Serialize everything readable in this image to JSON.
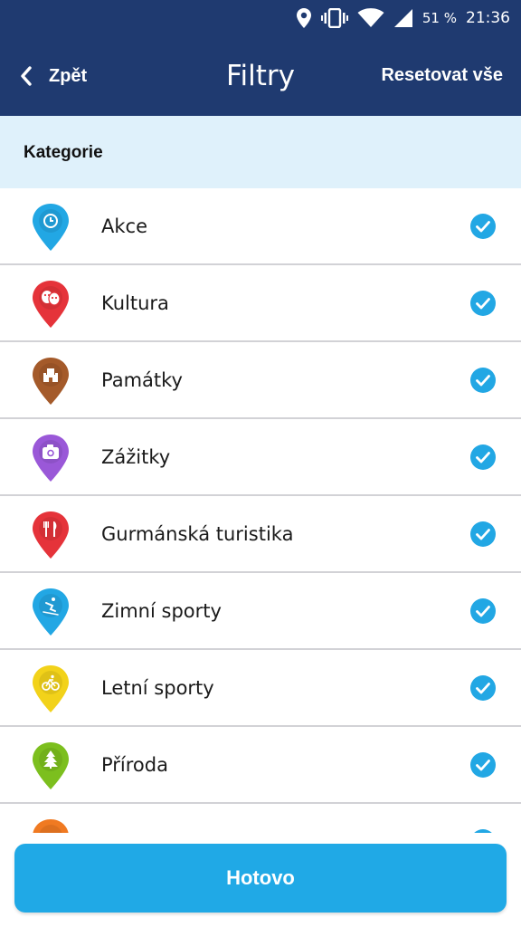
{
  "status_bar": {
    "battery_text": "51 %",
    "time": "21:36",
    "icons": [
      "location-icon",
      "vibrate-icon",
      "wifi-icon",
      "signal-icon"
    ]
  },
  "header": {
    "back_label": "Zpět",
    "title": "Filtry",
    "reset_label": "Resetovat vše"
  },
  "section": {
    "title": "Kategorie"
  },
  "categories": [
    {
      "label": "Akce",
      "color": "#22a7e4",
      "icon": "clock-icon",
      "checked": true
    },
    {
      "label": "Kultura",
      "color": "#e5333a",
      "icon": "theater-masks-icon",
      "checked": true
    },
    {
      "label": "Památky",
      "color": "#a45a2a",
      "icon": "castle-icon",
      "checked": true
    },
    {
      "label": "Zážitky",
      "color": "#9a58d8",
      "icon": "camera-icon",
      "checked": true
    },
    {
      "label": "Gurmánská turistika",
      "color": "#e5333a",
      "icon": "cutlery-icon",
      "checked": true
    },
    {
      "label": "Zimní sporty",
      "color": "#22a7e4",
      "icon": "skier-icon",
      "checked": true
    },
    {
      "label": "Letní sporty",
      "color": "#f2d21a",
      "icon": "bicycle-icon",
      "checked": true
    },
    {
      "label": "Příroda",
      "color": "#7cbf1e",
      "icon": "tree-icon",
      "checked": true
    },
    {
      "label": "",
      "color": "#f07a22",
      "icon": "pin-icon",
      "checked": true
    }
  ],
  "footer": {
    "done_label": "Hotovo"
  },
  "colors": {
    "header_bg": "#1f3a70",
    "section_bg": "#dff1fb",
    "accent": "#20a9e6",
    "check": "#22a7e4"
  }
}
